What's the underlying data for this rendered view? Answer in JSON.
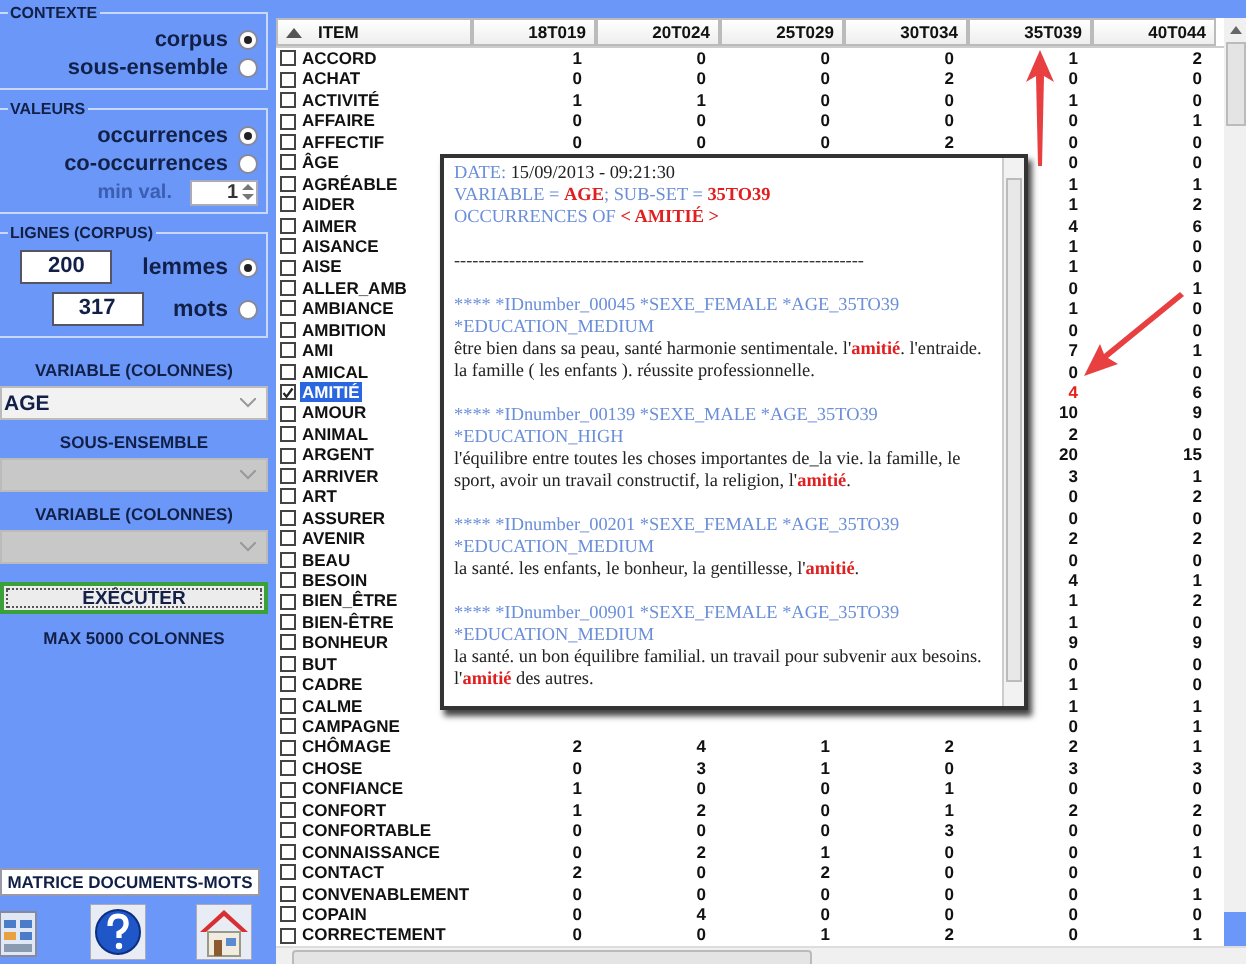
{
  "sidebar": {
    "contexte": {
      "title": "CONTEXTE",
      "options": [
        {
          "label": "corpus",
          "selected": true
        },
        {
          "label": "sous-ensemble",
          "selected": false
        }
      ]
    },
    "valeurs": {
      "title": "VALEURS",
      "options": [
        {
          "label": "occurrences",
          "selected": true
        },
        {
          "label": "co-occurrences",
          "selected": false
        }
      ],
      "min_label": "min val.",
      "min_value": "1"
    },
    "lignes": {
      "title": "LIGNES (CORPUS)",
      "options": [
        {
          "value": "200",
          "label": "lemmes",
          "selected": true
        },
        {
          "value": "317",
          "label": "mots",
          "selected": false
        }
      ]
    },
    "selects": [
      {
        "label": "VARIABLE (COLONNES)",
        "value": "AGE",
        "disabled": false
      },
      {
        "label": "SOUS-ENSEMBLE",
        "disabled": true
      },
      {
        "label": "VARIABLE (COLONNES)",
        "disabled": true
      }
    ],
    "run_button": "EXÉCUTER",
    "max_note": "MAX 5000 COLONNES",
    "matrix_button": "MATRICE DOCUMENTS-MOTS"
  },
  "table": {
    "item_column": "ITEM",
    "columns": [
      "18T019",
      "20T024",
      "25T029",
      "30T034",
      "35T039",
      "40T044"
    ],
    "rows": [
      {
        "item": "ACCORD",
        "checked": false,
        "selected": false,
        "cells": [
          "1",
          "0",
          "0",
          "0",
          "1",
          "2"
        ]
      },
      {
        "item": "ACHAT",
        "checked": false,
        "selected": false,
        "cells": [
          "0",
          "0",
          "0",
          "2",
          "0",
          "0"
        ]
      },
      {
        "item": "ACTIVITÉ",
        "checked": false,
        "selected": false,
        "cells": [
          "1",
          "1",
          "0",
          "0",
          "1",
          "0"
        ]
      },
      {
        "item": "AFFAIRE",
        "checked": false,
        "selected": false,
        "cells": [
          "0",
          "0",
          "0",
          "0",
          "0",
          "1"
        ]
      },
      {
        "item": "AFFECTIF",
        "checked": false,
        "selected": false,
        "cells": [
          "0",
          "0",
          "0",
          "2",
          "0",
          "0"
        ]
      },
      {
        "item": "ÂGE",
        "checked": false,
        "selected": false,
        "cells": [
          "0",
          "0"
        ]
      },
      {
        "item": "AGRÉABLE",
        "checked": false,
        "selected": false,
        "cells": [
          "1",
          "1"
        ]
      },
      {
        "item": "AIDER",
        "checked": false,
        "selected": false,
        "cells": [
          "1",
          "2"
        ]
      },
      {
        "item": "AIMER",
        "checked": false,
        "selected": false,
        "cells": [
          "4",
          "6"
        ]
      },
      {
        "item": "AISANCE",
        "checked": false,
        "selected": false,
        "cells": [
          "1",
          "0"
        ]
      },
      {
        "item": "AISE",
        "checked": false,
        "selected": false,
        "cells": [
          "1",
          "0"
        ]
      },
      {
        "item": "ALLER_AMB",
        "checked": false,
        "selected": false,
        "cells": [
          "0",
          "1"
        ]
      },
      {
        "item": "AMBIANCE",
        "checked": false,
        "selected": false,
        "cells": [
          "1",
          "0"
        ]
      },
      {
        "item": "AMBITION",
        "checked": false,
        "selected": false,
        "cells": [
          "0",
          "0"
        ]
      },
      {
        "item": "AMI",
        "checked": false,
        "selected": false,
        "cells": [
          "7",
          "1"
        ]
      },
      {
        "item": "AMICAL",
        "checked": false,
        "selected": false,
        "cells": [
          "0",
          "0"
        ]
      },
      {
        "item": "AMITIÉ",
        "checked": true,
        "selected": true,
        "cells": [
          "4",
          "6"
        ],
        "cell_highlight": [
          true,
          false
        ]
      },
      {
        "item": "AMOUR",
        "checked": false,
        "selected": false,
        "cells": [
          "10",
          "9"
        ]
      },
      {
        "item": "ANIMAL",
        "checked": false,
        "selected": false,
        "cells": [
          "2",
          "0"
        ]
      },
      {
        "item": "ARGENT",
        "checked": false,
        "selected": false,
        "cells": [
          "20",
          "15"
        ]
      },
      {
        "item": "ARRIVER",
        "checked": false,
        "selected": false,
        "cells": [
          "3",
          "1"
        ]
      },
      {
        "item": "ART",
        "checked": false,
        "selected": false,
        "cells": [
          "0",
          "2"
        ]
      },
      {
        "item": "ASSURER",
        "checked": false,
        "selected": false,
        "cells": [
          "0",
          "0"
        ]
      },
      {
        "item": "AVENIR",
        "checked": false,
        "selected": false,
        "cells": [
          "2",
          "2"
        ]
      },
      {
        "item": "BEAU",
        "checked": false,
        "selected": false,
        "cells": [
          "0",
          "0"
        ]
      },
      {
        "item": "BESOIN",
        "checked": false,
        "selected": false,
        "cells": [
          "4",
          "1"
        ]
      },
      {
        "item": "BIEN_ÊTRE",
        "checked": false,
        "selected": false,
        "cells": [
          "1",
          "2"
        ]
      },
      {
        "item": "BIEN-ÊTRE",
        "checked": false,
        "selected": false,
        "cells": [
          "1",
          "0"
        ]
      },
      {
        "item": "BONHEUR",
        "checked": false,
        "selected": false,
        "cells": [
          "9",
          "9"
        ]
      },
      {
        "item": "BUT",
        "checked": false,
        "selected": false,
        "cells": [
          "0",
          "0"
        ]
      },
      {
        "item": "CADRE",
        "checked": false,
        "selected": false,
        "cells": [
          "1",
          "0"
        ]
      },
      {
        "item": "CALME",
        "checked": false,
        "selected": false,
        "cells": [
          "1",
          "1"
        ]
      },
      {
        "item": "CAMPAGNE",
        "checked": false,
        "selected": false,
        "cells": [
          "0",
          "1"
        ]
      },
      {
        "item": "CHÔMAGE",
        "checked": false,
        "selected": false,
        "cells": [
          "2",
          "4",
          "1",
          "2",
          "2",
          "1"
        ]
      },
      {
        "item": "CHOSE",
        "checked": false,
        "selected": false,
        "cells": [
          "0",
          "3",
          "1",
          "0",
          "3",
          "3"
        ]
      },
      {
        "item": "CONFIANCE",
        "checked": false,
        "selected": false,
        "cells": [
          "1",
          "0",
          "0",
          "1",
          "0",
          "0"
        ]
      },
      {
        "item": "CONFORT",
        "checked": false,
        "selected": false,
        "cells": [
          "1",
          "2",
          "0",
          "1",
          "2",
          "2"
        ]
      },
      {
        "item": "CONFORTABLE",
        "checked": false,
        "selected": false,
        "cells": [
          "0",
          "0",
          "0",
          "3",
          "0",
          "0"
        ]
      },
      {
        "item": "CONNAISSANCE",
        "checked": false,
        "selected": false,
        "cells": [
          "0",
          "2",
          "1",
          "0",
          "0",
          "1"
        ]
      },
      {
        "item": "CONTACT",
        "checked": false,
        "selected": false,
        "cells": [
          "2",
          "0",
          "2",
          "0",
          "0",
          "0"
        ]
      },
      {
        "item": "CONVENABLEMENT",
        "checked": false,
        "selected": false,
        "cells": [
          "0",
          "0",
          "0",
          "0",
          "0",
          "1"
        ]
      },
      {
        "item": "COPAIN",
        "checked": false,
        "selected": false,
        "cells": [
          "0",
          "4",
          "0",
          "0",
          "0",
          "0"
        ]
      },
      {
        "item": "CORRECTEMENT",
        "checked": false,
        "selected": false,
        "cells": [
          "0",
          "0",
          "1",
          "2",
          "0",
          "1"
        ]
      }
    ]
  },
  "popup": {
    "date_label": "DATE:",
    "date": "15/09/2013 - 09:21:30",
    "lines": [
      "VARIABLE = **AGE**; SUB-SET = **35TO39**",
      "OCCURRENCES OF **< AMITIÉ >**"
    ],
    "separator": "-------------------------------------------------------------------",
    "entries": [
      {
        "header": "**** *IDnumber_00045 *SEXE_FEMALE *AGE_35TO39",
        "education": "*EDUCATION_MEDIUM",
        "text": "être bien dans sa peau, santé harmonie sentimentale. l'**amitié**. l'entraide. la famille ( les enfants ). réussite professionnelle."
      },
      {
        "header": "**** *IDnumber_00139 *SEXE_MALE *AGE_35TO39",
        "education": "*EDUCATION_HIGH",
        "text": "l'équilibre entre toutes les choses importantes de_la vie. la famille, le sport, avoir un travail constructif, la religion, l'**amitié**."
      },
      {
        "header": "**** *IDnumber_00201 *SEXE_FEMALE *AGE_35TO39",
        "education": "*EDUCATION_MEDIUM",
        "text": "la santé. les enfants, le bonheur, la gentillesse, l'**amitié**."
      },
      {
        "header": "**** *IDnumber_00901 *SEXE_FEMALE *AGE_35TO39",
        "education": "*EDUCATION_MEDIUM",
        "text": "la santé. un bon équilibre familial. un travail pour subvenir aux besoins. l'**amitié** des autres."
      }
    ]
  }
}
